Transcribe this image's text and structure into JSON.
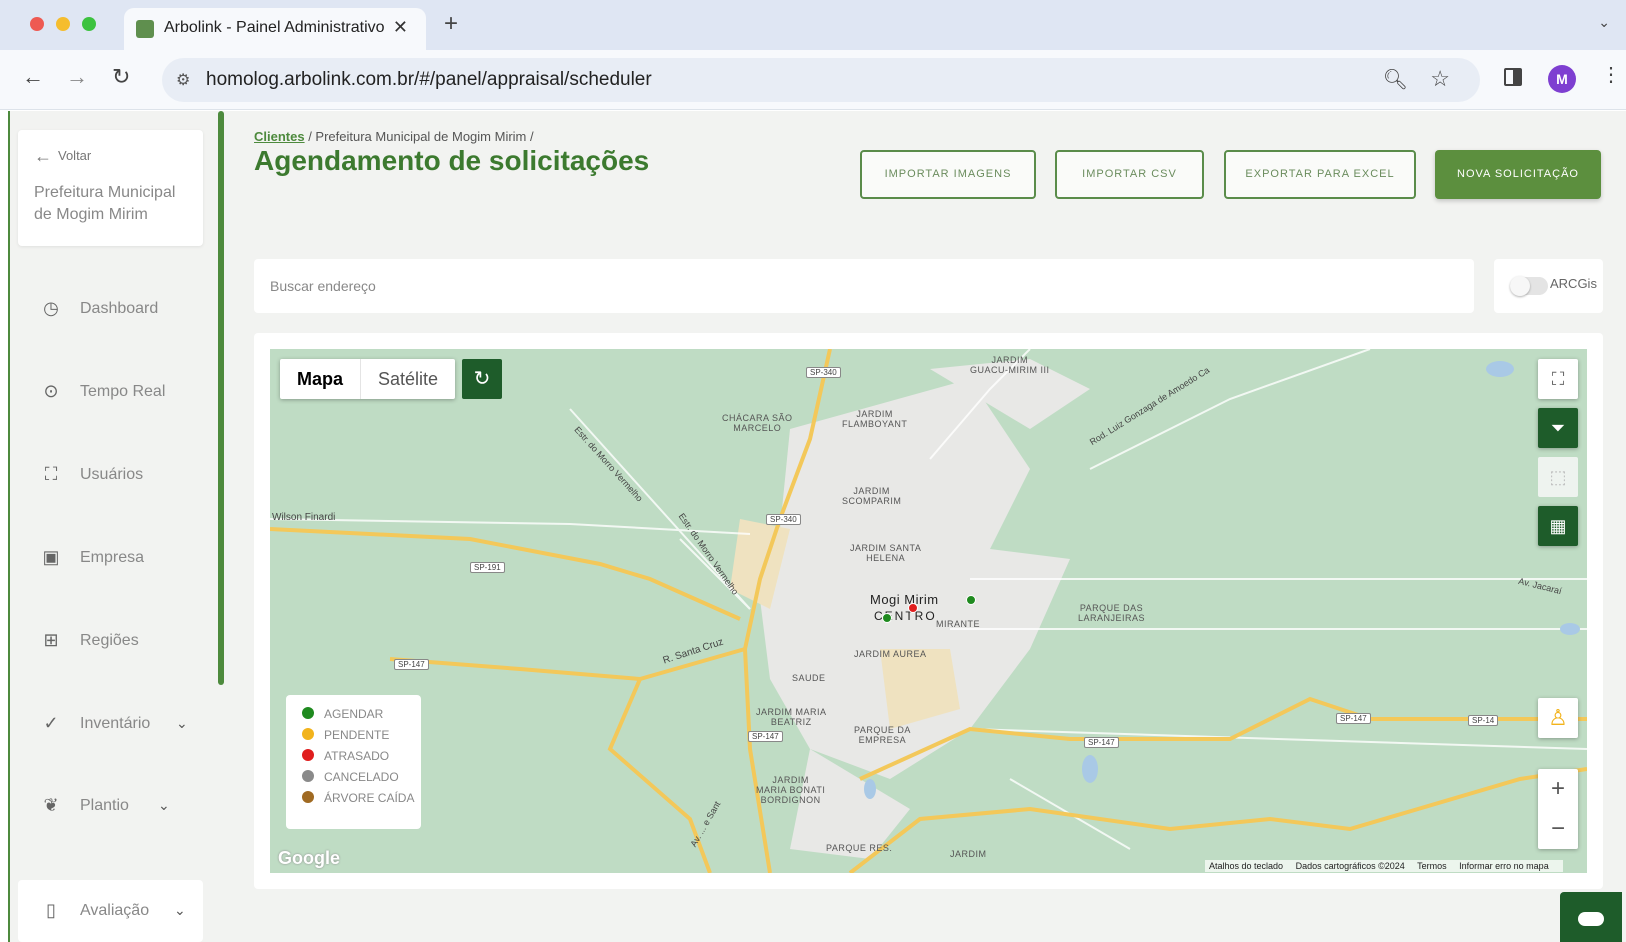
{
  "browser": {
    "tab_title": "Arbolink - Painel Administrativo",
    "url": "homolog.arbolink.com.br/#/panel/appraisal/scheduler",
    "profile_initial": "M"
  },
  "sidebar": {
    "back_label": "Voltar",
    "client_name": "Prefeitura Municipal de Mogim Mirim",
    "items": [
      {
        "label": "Dashboard",
        "icon": "clock-icon"
      },
      {
        "label": "Tempo Real",
        "icon": "target-icon"
      },
      {
        "label": "Usuários",
        "icon": "users-icon"
      },
      {
        "label": "Empresa",
        "icon": "briefcase-icon"
      },
      {
        "label": "Regiões",
        "icon": "map-icon"
      },
      {
        "label": "Inventário",
        "icon": "check-circle-icon"
      },
      {
        "label": "Plantio",
        "icon": "leaf-icon"
      },
      {
        "label": "Avaliação",
        "icon": "clipboard-icon"
      }
    ]
  },
  "breadcrumb": {
    "clients": "Clientes",
    "rest": "/ Prefeitura Municipal de Mogim Mirim /"
  },
  "page": {
    "title": "Agendamento de solicitações"
  },
  "actions": {
    "import_images": "IMPORTAR IMAGENS",
    "import_csv": "IMPORTAR CSV",
    "export_excel": "EXPORTAR PARA EXCEL",
    "new_request": "NOVA SOLICITAÇÃO"
  },
  "search": {
    "placeholder": "Buscar endereço",
    "arcgis_label": "ARCGis"
  },
  "map": {
    "type_map": "Mapa",
    "type_satellite": "Satélite",
    "legend": [
      {
        "label": "AGENDAR",
        "color": "#1f8a1f"
      },
      {
        "label": "PENDENTE",
        "color": "#f2b31c"
      },
      {
        "label": "ATRASADO",
        "color": "#e01e1e"
      },
      {
        "label": "CANCELADO",
        "color": "#8a8a8a"
      },
      {
        "label": "ÁRVORE CAÍDA",
        "color": "#a06a22"
      }
    ],
    "google_logo": "Google",
    "footer": {
      "shortcuts": "Atalhos do teclado",
      "data": "Dados cartográficos ©2024",
      "terms": "Termos",
      "report": "Informar erro no mapa"
    },
    "places": {
      "city": "Mogi Mirim",
      "centro": "CENTRO",
      "mirante": "MIRANTE",
      "jardim_aurea": "JARDIM AUREA",
      "saude": "SAUDE",
      "jardim_maria_beatriz": "JARDIM MARIA\nBEATRIZ",
      "parque_empresa": "PARQUE DA\nEMPRESA",
      "jardim_maria_bonati": "JARDIM\nMARIA BONATI\nBORDIGNON",
      "parque_laranjeiras": "PARQUE DAS\nLARANJEIRAS",
      "jardim_santa_helena": "JARDIM SANTA\nHELENA",
      "jardim_scomparim": "JARDIM\nSCOMPARIM",
      "chacara_sao_marcelo": "CHÁCARA SÃO\nMARCELO",
      "jardim_flamboyant": "JARDIM\nFLAMBOYANT",
      "jardim_guacu": "JARDIM\nGUACU-MIRIM III",
      "parque_res": "PARQUE RES.",
      "jardim_bottom": "JARDIM",
      "wilson_finardi": "Wilson Finardi",
      "r_santa_cruz": "R. Santa Cruz",
      "estr_morro_1": "Estr. do Morro Vermelho",
      "estr_morro_2": "Estr. do Morro Vermelho",
      "rod_luiz": "Rod. Luiz Gonzaga de Amoedo Ca",
      "av_jacarai": "Av. Jacaraí",
      "av_bottom": "Av. ... e Sant"
    },
    "roads": [
      "SP-340",
      "SP-340",
      "SP-191",
      "SP-147",
      "SP-147",
      "SP-147",
      "SP-147",
      "SP-14"
    ],
    "pins": [
      {
        "status": "AGENDAR",
        "color": "#1f8a1f"
      },
      {
        "status": "ATRASADO",
        "color": "#e01e1e"
      },
      {
        "status": "AGENDAR",
        "color": "#1f8a1f"
      }
    ]
  }
}
